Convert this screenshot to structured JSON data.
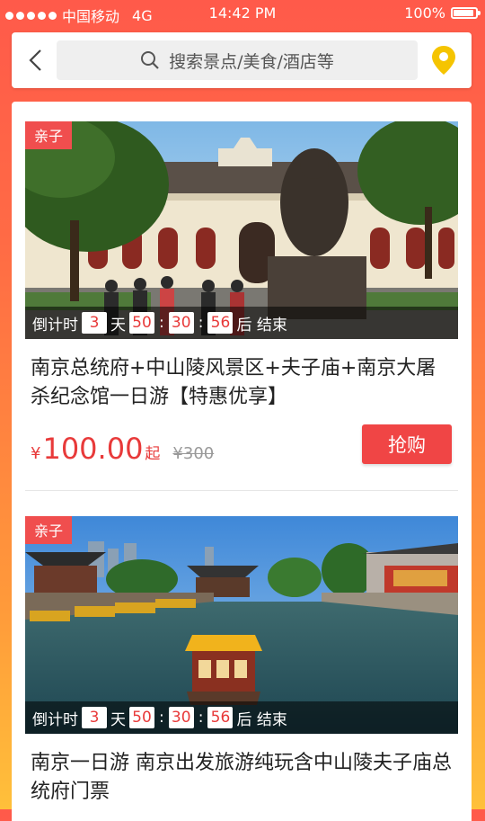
{
  "status_bar": {
    "carrier": "中国移动",
    "network": "4G",
    "time": "14:42 PM",
    "battery": "100%",
    "battery_level": 1.0
  },
  "search": {
    "placeholder": "搜索景点/美食/酒店等"
  },
  "icons": {
    "back": "back-chevron-icon",
    "search": "search-icon",
    "location": "location-pin-icon"
  },
  "colors": {
    "accent": "#f04545",
    "price": "#e83a3a",
    "location_pin": "#f5c400"
  },
  "cards": [
    {
      "tag": "亲子",
      "countdown": {
        "prefix": "倒计时",
        "days": "3",
        "day_unit": "天",
        "hours": "50",
        "minutes": "30",
        "seconds": "56",
        "suffix": "后 结束"
      },
      "title": "南京总统府+中山陵风景区+夫子庙+南京大屠杀纪念馆一日游【特惠优享】",
      "price_symbol": "¥",
      "price": "100.00",
      "price_suffix": "起",
      "original_price": "¥300",
      "buy_label": "抢购"
    },
    {
      "tag": "亲子",
      "countdown": {
        "prefix": "倒计时",
        "days": "3",
        "day_unit": "天",
        "hours": "50",
        "minutes": "30",
        "seconds": "56",
        "suffix": "后 结束"
      },
      "title": "南京一日游 南京出发旅游纯玩含中山陵夫子庙总统府门票"
    }
  ]
}
